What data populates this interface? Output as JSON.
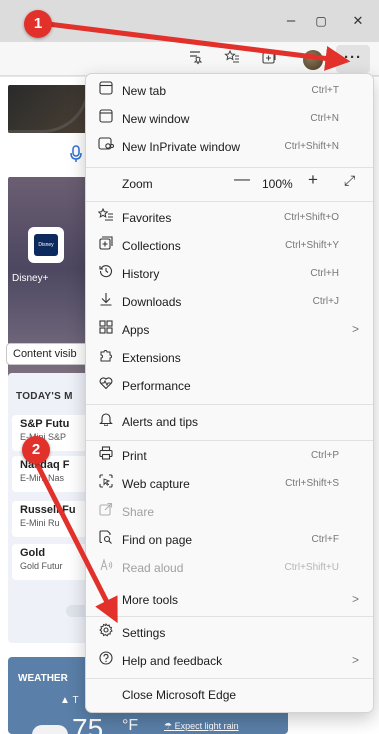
{
  "window": {
    "minimize": "–",
    "maximize": "▢",
    "close": "✕"
  },
  "toolbar": {
    "more_label": "···"
  },
  "page": {
    "disney_label": "Disney+",
    "disney_logo_text": "Disney",
    "content_visibility": "Content visib",
    "markets_title": "TODAY'S M",
    "markets": [
      {
        "name": "S&P Futu",
        "sub": "E-Mini S&P"
      },
      {
        "name": "Nasdaq F",
        "sub": "E-Mini Nas"
      },
      {
        "name": "Russell Fu",
        "sub": "E-Mini Ru"
      },
      {
        "name": "Gold",
        "sub": "Gold Futur"
      }
    ],
    "weather_title": "WEATHER",
    "weather_location": "T",
    "weather_temp": "75",
    "weather_unit": "°F",
    "weather_alert": "Expect light rain"
  },
  "menu": {
    "items": [
      {
        "label": "New tab",
        "shortcut": "Ctrl+T",
        "icon": "new-tab-icon"
      },
      {
        "label": "New window",
        "shortcut": "Ctrl+N",
        "icon": "new-window-icon"
      },
      {
        "label": "New InPrivate window",
        "shortcut": "Ctrl+Shift+N",
        "icon": "inprivate-icon"
      },
      {
        "label": "Zoom",
        "shortcut": "",
        "icon": ""
      },
      {
        "label": "Favorites",
        "shortcut": "Ctrl+Shift+O",
        "icon": "favorites-icon"
      },
      {
        "label": "Collections",
        "shortcut": "Ctrl+Shift+Y",
        "icon": "collections-icon"
      },
      {
        "label": "History",
        "shortcut": "Ctrl+H",
        "icon": "history-icon"
      },
      {
        "label": "Downloads",
        "shortcut": "Ctrl+J",
        "icon": "downloads-icon"
      },
      {
        "label": "Apps",
        "shortcut": "",
        "icon": "apps-icon"
      },
      {
        "label": "Extensions",
        "shortcut": "",
        "icon": "extensions-icon"
      },
      {
        "label": "Performance",
        "shortcut": "",
        "icon": "performance-icon"
      },
      {
        "label": "Alerts and tips",
        "shortcut": "",
        "icon": "bell-icon"
      },
      {
        "label": "Print",
        "shortcut": "Ctrl+P",
        "icon": "print-icon"
      },
      {
        "label": "Web capture",
        "shortcut": "Ctrl+Shift+S",
        "icon": "web-capture-icon"
      },
      {
        "label": "Share",
        "shortcut": "",
        "icon": "share-icon"
      },
      {
        "label": "Find on page",
        "shortcut": "Ctrl+F",
        "icon": "find-icon"
      },
      {
        "label": "Read aloud",
        "shortcut": "Ctrl+Shift+U",
        "icon": "read-aloud-icon"
      },
      {
        "label": "More tools",
        "shortcut": "",
        "icon": "more-tools-icon"
      },
      {
        "label": "Settings",
        "shortcut": "",
        "icon": "gear-icon"
      },
      {
        "label": "Help and feedback",
        "shortcut": "",
        "icon": "help-icon"
      },
      {
        "label": "Close Microsoft Edge",
        "shortcut": "",
        "icon": ""
      }
    ],
    "zoom_minus": "—",
    "zoom_value": "100%",
    "zoom_plus": "+",
    "zoom_fullscreen": "⤢",
    "chevron": ">"
  },
  "annotations": {
    "badge_1": "1",
    "badge_2": "2",
    "arrow_color": "#e2312b"
  }
}
